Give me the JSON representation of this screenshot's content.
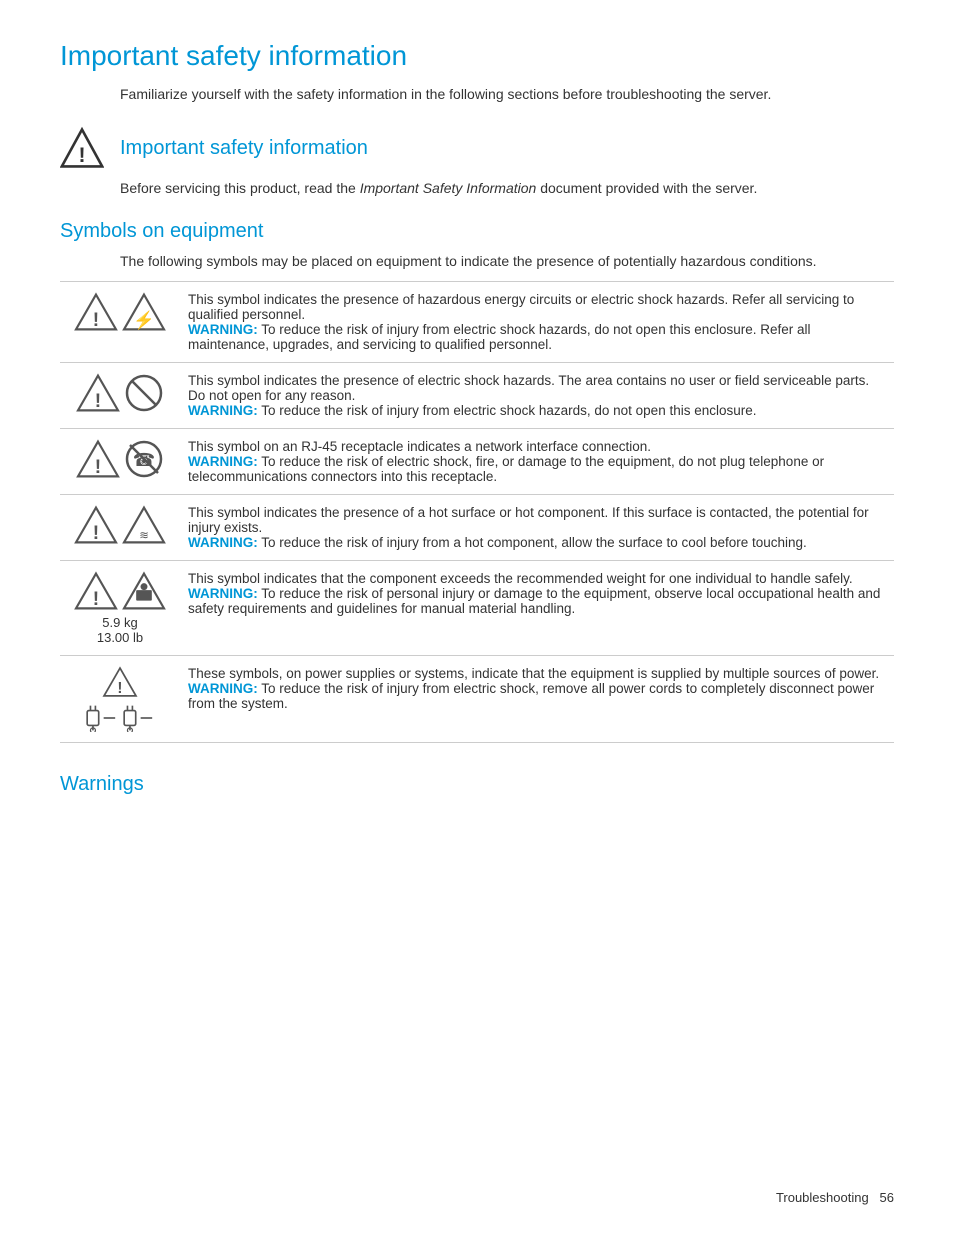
{
  "page": {
    "main_title": "Important safety information",
    "intro": "Familiarize yourself with the safety information in the following sections before troubleshooting the server.",
    "subsection1": {
      "title": "Important safety information",
      "body_prefix": "Before servicing this product, read the ",
      "body_italic": "Important Safety Information",
      "body_suffix": " document provided with the server."
    },
    "subsection2": {
      "title": "Symbols on equipment",
      "intro": "The following symbols may be placed on equipment to indicate the presence of potentially hazardous conditions.",
      "symbols": [
        {
          "id": "hazardous-energy",
          "description": "This symbol indicates the presence of hazardous energy circuits or electric shock hazards. Refer all servicing to qualified personnel.",
          "warning": "To reduce the risk of injury from electric shock hazards, do not open this enclosure. Refer all maintenance, upgrades, and servicing to qualified personnel."
        },
        {
          "id": "electric-shock-no-service",
          "description": "This symbol indicates the presence of electric shock hazards. The area contains no user or field serviceable parts. Do not open for any reason.",
          "warning": "To reduce the risk of injury from electric shock hazards, do not open this enclosure."
        },
        {
          "id": "network-interface",
          "description": "This symbol on an RJ-45 receptacle indicates a network interface connection.",
          "warning": "To reduce the risk of electric shock, fire, or damage to the equipment, do not plug telephone or telecommunications connectors into this receptacle."
        },
        {
          "id": "hot-surface",
          "description": "This symbol indicates the presence of a hot surface or hot component. If this surface is contacted, the potential for injury exists.",
          "warning": "To reduce the risk of injury from a hot component, allow the surface to cool before touching."
        },
        {
          "id": "heavy-weight",
          "description": "This symbol indicates that the component exceeds the recommended weight for one individual to handle safely.",
          "warning": "To reduce the risk of personal injury or damage to the equipment, observe local occupational health and safety requirements and guidelines for manual material handling.",
          "weight1": "5.9 kg",
          "weight2": "13.00 lb"
        },
        {
          "id": "multiple-power",
          "description": "These symbols, on power supplies or systems, indicate that the equipment is supplied by multiple sources of power.",
          "warning": "To reduce the risk of injury from electric shock, remove all power cords to completely disconnect power from the system."
        }
      ]
    },
    "subsection3": {
      "title": "Warnings"
    },
    "footer": {
      "text": "Troubleshooting",
      "page_number": "56"
    }
  }
}
